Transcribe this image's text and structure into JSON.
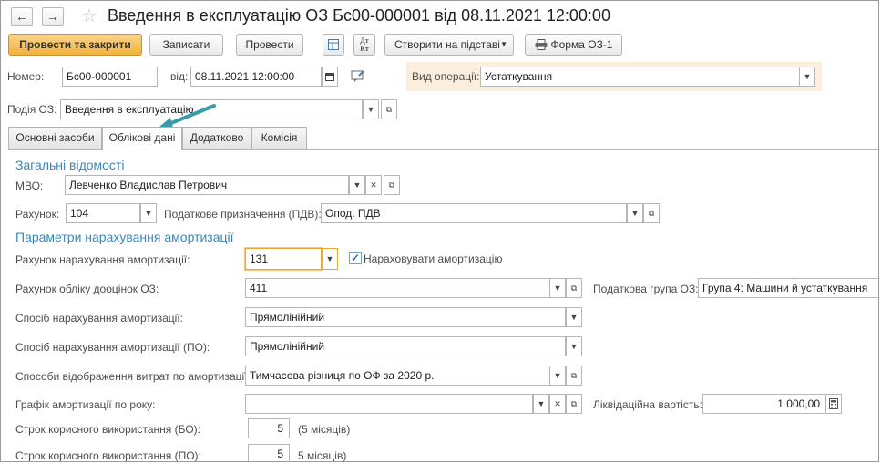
{
  "window": {
    "title": "Введення в експлуатацію ОЗ Бс00-000001 від 08.11.2021 12:00:00",
    "back_glyph": "←",
    "forward_glyph": "→",
    "star_glyph": "☆"
  },
  "toolbar": {
    "post_close": "Провести та закрити",
    "save": "Записати",
    "post": "Провести",
    "create_based": "Створити на підставі",
    "form": "Форма ОЗ-1",
    "dt_kt": "Дт\nКт"
  },
  "header": {
    "number_label": "Номер:",
    "number_value": "Бс00-000001",
    "date_label": "від:",
    "date_value": "08.11.2021 12:00:00",
    "operation_label": "Вид операції:",
    "operation_value": "Устаткування",
    "event_label": "Подія ОЗ:",
    "event_value": "Введення в експлуатацію"
  },
  "tabs": [
    {
      "label": "Основні засоби",
      "active": false
    },
    {
      "label": "Облікові дані",
      "active": true
    },
    {
      "label": "Додатково",
      "active": false
    },
    {
      "label": "Комісія",
      "active": false
    }
  ],
  "general": {
    "section_title": "Загальні відомості",
    "mvo_label": "МВО:",
    "mvo_value": "Левченко Владислав Петрович",
    "account_label": "Рахунок:",
    "account_value": "104",
    "tax_purpose_label": "Податкове призначення (ПДВ):",
    "tax_purpose_value": "Опод. ПДВ"
  },
  "depreciation": {
    "section_title": "Параметри нарахування амортизації",
    "dep_account_label": "Рахунок нарахування амортизації:",
    "dep_account_value": "131",
    "accrue_checkbox_label": "Нараховувати амортизацію",
    "accrue_checked": true,
    "reval_account_label": "Рахунок обліку дооцінок ОЗ:",
    "reval_account_value": "411",
    "tax_group_label": "Податкова група ОЗ:",
    "tax_group_value": "Група 4: Машини й устаткування",
    "method_label": "Спосіб нарахування амортизації:",
    "method_value": "Прямолінійний",
    "method_po_label": "Спосіб нарахування амортизації (ПО):",
    "method_po_value": "Прямолінійний",
    "expense_label": "Способи відображення витрат по амортизації:",
    "expense_value": "Тимчасова різниця по ОФ за 2020 р.",
    "schedule_label": "Графік амортизації по року:",
    "schedule_value": "",
    "liquidation_label": "Ліквідаційна вартість:",
    "liquidation_value": "1 000,00",
    "life_bo_label": "Строк корисного використання (БО):",
    "life_bo_value": "5",
    "life_bo_note": "(5 місяців)",
    "life_po_label": "Строк корисного використання (ПО):",
    "life_po_value": "5",
    "life_po_note": "5 місяців)"
  },
  "colors": {
    "accent": "#3b87b8",
    "primary_button": "#f2b23c",
    "operation_highlight": "#fbeedd",
    "arrow": "#3a9aa8"
  }
}
